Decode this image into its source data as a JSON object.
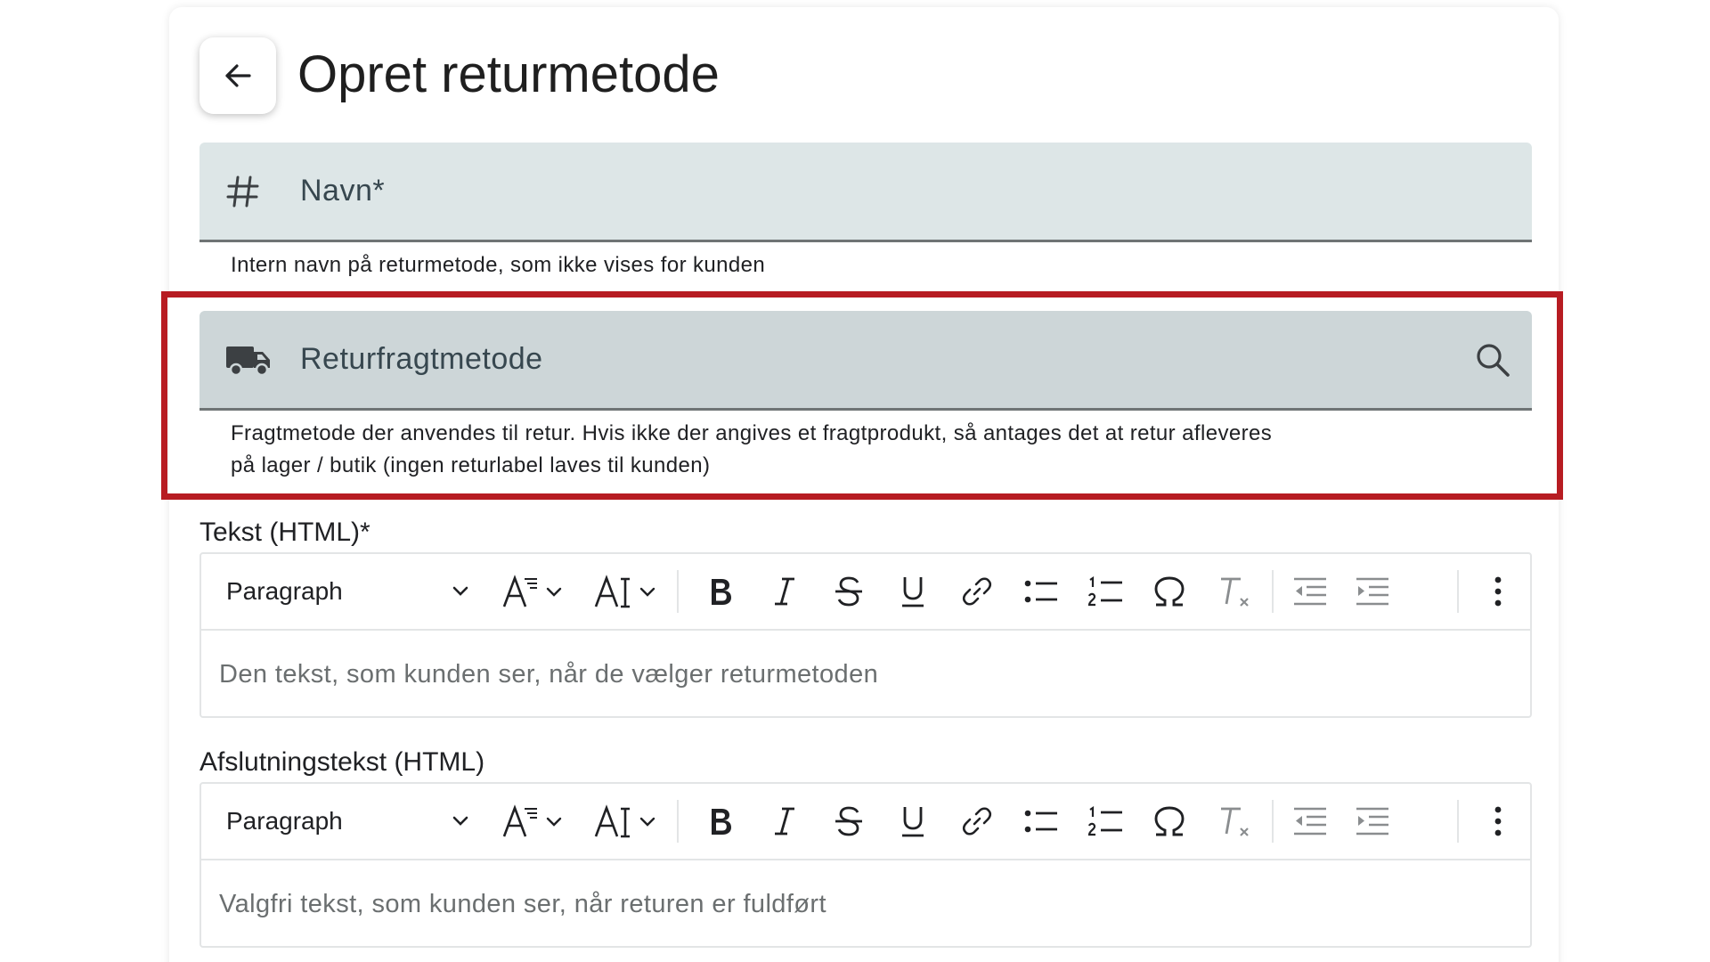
{
  "header": {
    "title": "Opret returmetode",
    "back_icon": "arrow-left-icon"
  },
  "name_field": {
    "label": "Navn*",
    "icon": "hash-icon",
    "helper": "Intern navn på returmetode, som ikke vises for kunden"
  },
  "freight_field": {
    "label": "Returfragtmetode",
    "icon": "truck-icon",
    "trailing_icon": "search-icon",
    "helper_line1": "Fragtmetode der anvendes til retur. Hvis ikke der angives et fragtprodukt, så antages det at retur afleveres",
    "helper_line2": "på lager / butik (ingen returlabel laves til kunden)"
  },
  "highlight_color": "#b71c22",
  "editors": [
    {
      "label": "Tekst (HTML)*",
      "block_format": "Paragraph",
      "placeholder": "Den tekst, som kunden ser, når de vælger returmetoden"
    },
    {
      "label": "Afslutningstekst (HTML)",
      "block_format": "Paragraph",
      "placeholder": "Valgfri tekst, som kunden ser, når returen er fuldført"
    }
  ],
  "toolbar_icons": [
    "font-size-icon",
    "font-case-icon",
    "bold-icon",
    "italic-icon",
    "strikethrough-icon",
    "underline-icon",
    "link-icon",
    "bulleted-list-icon",
    "numbered-list-icon",
    "special-characters-icon",
    "remove-format-icon",
    "outdent-icon",
    "indent-icon",
    "more-options-icon"
  ],
  "colors": {
    "name_field_bg": "#dde6e7",
    "freight_field_bg": "#cdd6d8",
    "field_underline": "#6f7475"
  }
}
